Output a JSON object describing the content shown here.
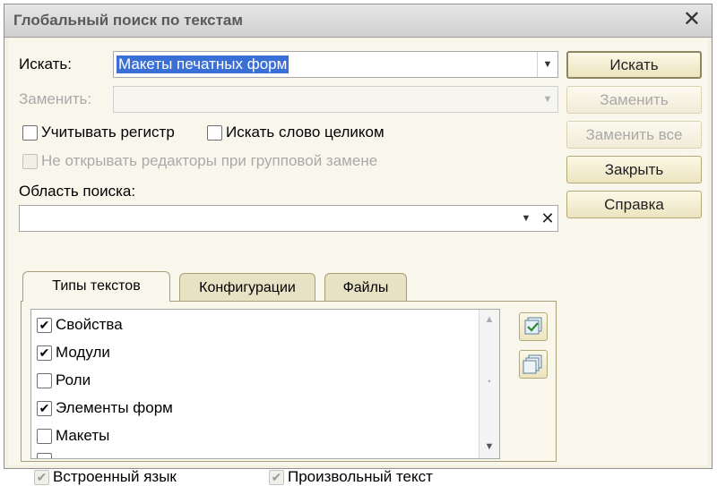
{
  "window": {
    "title": "Глобальный поиск по текстам"
  },
  "search": {
    "label": "Искать:",
    "value": "Макеты печатных форм"
  },
  "replace": {
    "label": "Заменить:",
    "value": ""
  },
  "options": {
    "case": "Учитывать регистр",
    "whole_word": "Искать слово целиком",
    "no_editors": "Не открывать редакторы при групповой замене"
  },
  "scope": {
    "label": "Область поиска:",
    "value": ""
  },
  "buttons": {
    "search": "Искать",
    "replace": "Заменить",
    "replace_all": "Заменить все",
    "close": "Закрыть",
    "help": "Справка"
  },
  "tabs": [
    "Типы текстов",
    "Конфигурации",
    "Файлы"
  ],
  "text_types": [
    {
      "label": "Свойства",
      "checked": true
    },
    {
      "label": "Модули",
      "checked": true
    },
    {
      "label": "Роли",
      "checked": false
    },
    {
      "label": "Элементы форм",
      "checked": true
    },
    {
      "label": "Макеты",
      "checked": false
    },
    {
      "label": "",
      "checked": false
    }
  ],
  "footer": {
    "builtin_lang": "Встроенный язык",
    "free_text": "Произвольный текст"
  },
  "icons": {
    "close": "close-icon",
    "dropdown": "chevron-down-icon",
    "clear": "clear-icon",
    "check_all": "check-all-icon",
    "uncheck_all": "uncheck-all-icon"
  }
}
